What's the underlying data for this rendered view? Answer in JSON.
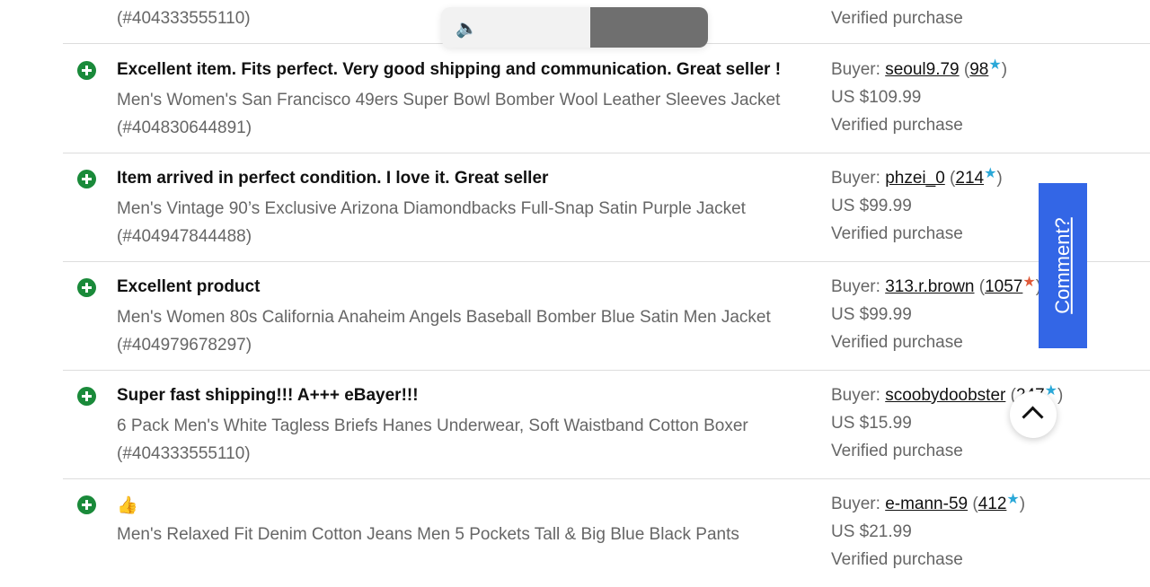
{
  "top_partial": {
    "product_ref": "(#404333555110)",
    "verified": "Verified purchase"
  },
  "audio_control": {
    "icon": "speaker-icon"
  },
  "reviews": [
    {
      "title": "Excellent item. Fits perfect. Very good shipping and communication. Great seller !",
      "product_line1": "Men's Women's San Francisco 49ers Super Bowl Bomber Wool Leather Sleeves Jacket",
      "product_line2": "(#404830644891)",
      "buyer_label": "Buyer:",
      "buyer_name": "seoul9.79",
      "feedback": "98",
      "star_color": "#2aa8d8",
      "price": "US $109.99",
      "verified": "Verified purchase"
    },
    {
      "title": "Item arrived in perfect condition. I love it. Great seller",
      "product_line1": "Men's Vintage 90’s Exclusive Arizona Diamondbacks Full-Snap Satin Purple Jacket",
      "product_line2": "(#404947844488)",
      "buyer_label": "Buyer:",
      "buyer_name": "phzei_0",
      "feedback": "214",
      "star_color": "#2aa8d8",
      "price": "US $99.99",
      "verified": "Verified purchase"
    },
    {
      "title": "Excellent product",
      "product_line1": "Men's Women 80s California Anaheim Angels Baseball Bomber Blue Satin Men Jacket",
      "product_line2": "(#404979678297)",
      "buyer_label": "Buyer:",
      "buyer_name": "313.r.brown",
      "feedback": "1057",
      "star_color": "#e05a3a",
      "price": "US $99.99",
      "verified": "Verified purchase"
    },
    {
      "title": "Super fast shipping!!! A+++ eBayer!!!",
      "product_line1": "6 Pack Men's White Tagless Briefs Hanes Underwear, Soft Waistband Cotton Boxer",
      "product_line2": "(#404333555110)",
      "buyer_label": "Buyer:",
      "buyer_name": "scoobydoobster",
      "feedback": "247",
      "star_color": "#2aa8d8",
      "price": "US $15.99",
      "verified": "Verified purchase"
    },
    {
      "title": "👍",
      "product_line1": "Men's Relaxed Fit Denim Cotton Jeans Men 5 Pockets Tall & Big Blue Black Pants",
      "product_line2": "",
      "buyer_label": "Buyer:",
      "buyer_name": "e-mann-59",
      "feedback": "412",
      "star_color": "#2aa8d8",
      "price": "US $21.99",
      "verified": "Verified purchase"
    }
  ],
  "comment_tab": {
    "label": "Comment?",
    "color": "#3366e6"
  },
  "scroll_top": {
    "icon": "chevron-up-icon"
  }
}
